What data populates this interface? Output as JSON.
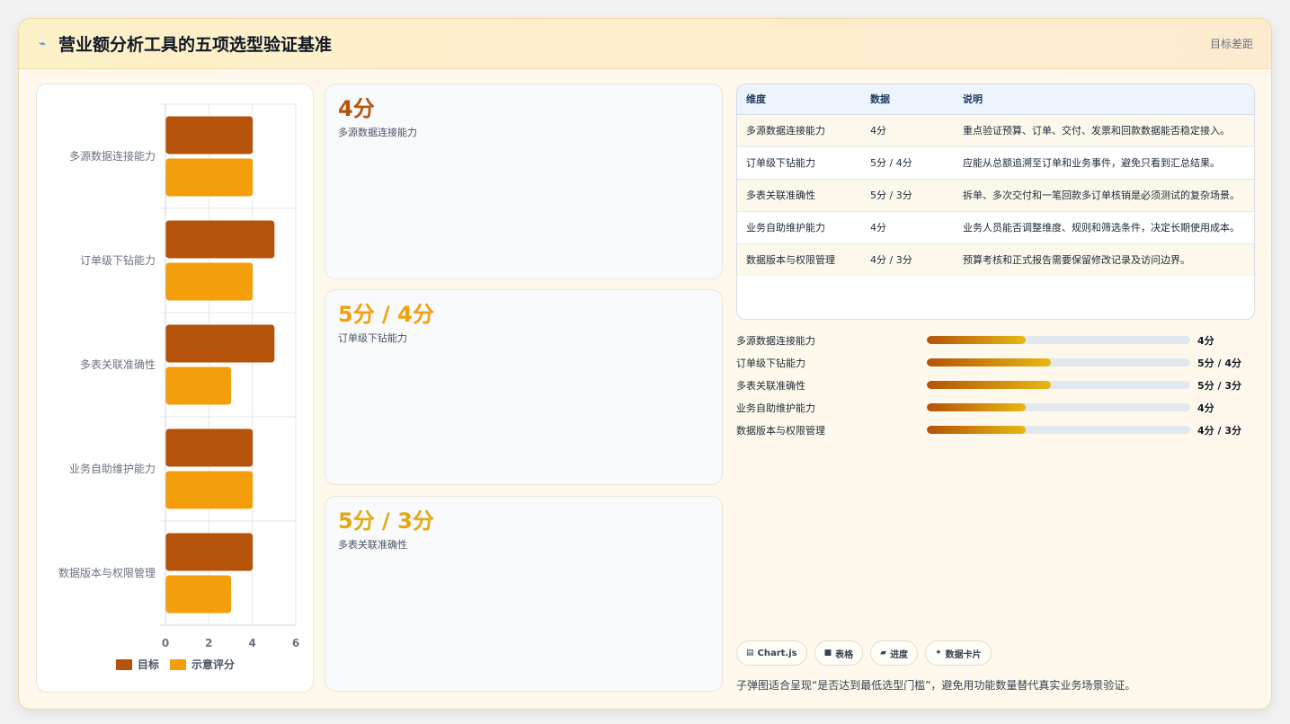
{
  "header": {
    "icon": "bolt-icon",
    "title": "营业额分析工具的五项选型验证基准",
    "tag": "目标差距"
  },
  "chart_data": {
    "type": "bar",
    "orientation": "horizontal",
    "categories": [
      "多源数据连接能力",
      "订单级下钻能力",
      "多表关联准确性",
      "业务自助维护能力",
      "数据版本与权限管理"
    ],
    "series": [
      {
        "name": "目标",
        "color": "#b45309",
        "values": [
          4,
          5,
          5,
          4,
          4
        ]
      },
      {
        "name": "示意评分",
        "color": "#f59e0b",
        "values": [
          4,
          4,
          3,
          4,
          3
        ]
      }
    ],
    "xlim": [
      0,
      6
    ],
    "xticks": [
      "0",
      "2",
      "4",
      "6"
    ],
    "grid": true,
    "legend": "bottom"
  },
  "kpis": [
    {
      "value": "4分",
      "label": "多源数据连接能力",
      "color": "#b45309"
    },
    {
      "value": "5分 / 4分",
      "label": "订单级下钻能力",
      "color": "#f59e0b"
    },
    {
      "value": "5分 / 3分",
      "label": "多表关联准确性",
      "color": "#e5a812"
    }
  ],
  "table": {
    "headers": [
      "维度",
      "数据",
      "说明"
    ],
    "rows": [
      [
        "多源数据连接能力",
        "4分",
        "重点验证预算、订单、交付、发票和回款数据能否稳定接入。"
      ],
      [
        "订单级下钻能力",
        "5分 / 4分",
        "应能从总额追溯至订单和业务事件，避免只看到汇总结果。"
      ],
      [
        "多表关联准确性",
        "5分 / 3分",
        "拆单、多次交付和一笔回款多订单核销是必须测试的复杂场景。"
      ],
      [
        "业务自助维护能力",
        "4分",
        "业务人员能否调整维度、规则和筛选条件，决定长期使用成本。"
      ],
      [
        "数据版本与权限管理",
        "4分 / 3分",
        "预算考核和正式报告需要保留修改记录及访问边界。"
      ]
    ]
  },
  "progress": [
    {
      "label": "多源数据连接能力",
      "value": "4分",
      "fraction": 0.375
    },
    {
      "label": "订单级下钻能力",
      "value": "5分 / 4分",
      "fraction": 0.47
    },
    {
      "label": "多表关联准确性",
      "value": "5分 / 3分",
      "fraction": 0.47
    },
    {
      "label": "业务自助维护能力",
      "value": "4分",
      "fraction": 0.375
    },
    {
      "label": "数据版本与权限管理",
      "value": "4分 / 3分",
      "fraction": 0.375
    }
  ],
  "chips": [
    {
      "icon": "chart-icon",
      "glyph": "▤",
      "label": "Chart.js"
    },
    {
      "icon": "table-icon",
      "glyph": "■",
      "label": "表格"
    },
    {
      "icon": "progress-icon",
      "glyph": "▰",
      "label": "进度"
    },
    {
      "icon": "card-icon",
      "glyph": "✦",
      "label": "数据卡片"
    }
  ],
  "footnote": "子弹图适合呈现“是否达到最低选型门槛”，避免用功能数量替代真实业务场景验证。"
}
